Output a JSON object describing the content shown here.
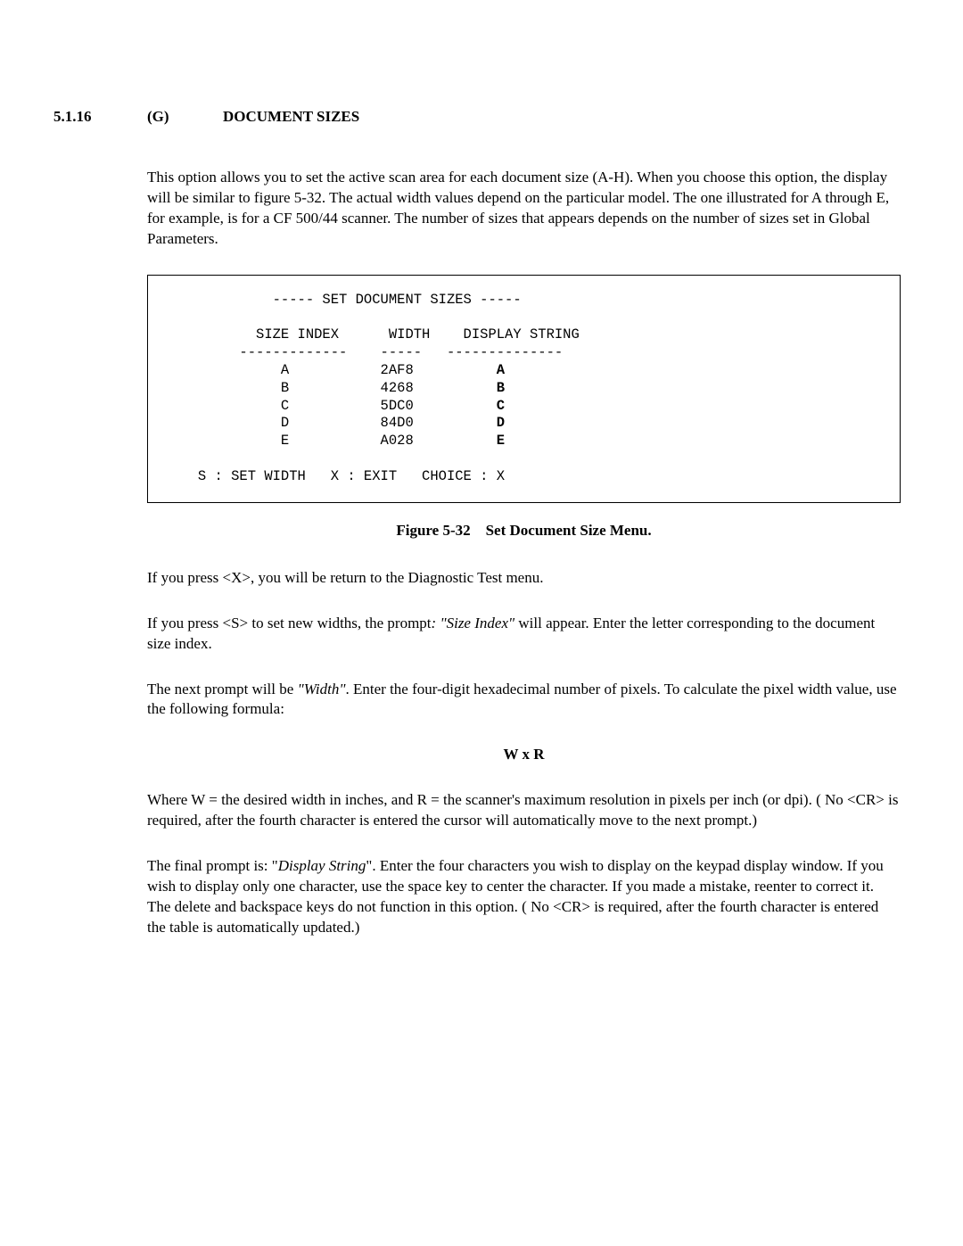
{
  "heading": {
    "num": "5.1.16",
    "letter": "(G)",
    "title": "DOCUMENT SIZES"
  },
  "para1": "This option allows you to set the active scan area for each document size (A-H).  When you choose this option, the display will be similar to figure 5-32.  The actual width values depend on the particular model.  The one illustrated for A through E, for example, is for a CF 500/44 scanner.  The number of sizes that appears depends on the number of sizes set in Global Parameters.",
  "figure": {
    "title": "----- SET DOCUMENT SIZES -----",
    "columns": {
      "c1": "SIZE INDEX",
      "c2": "WIDTH",
      "c3": "DISPLAY STRING"
    },
    "dividers": {
      "d1": "-------------",
      "d2": "-----",
      "d3": "--------------"
    },
    "rows": [
      {
        "idx": "A",
        "width": "2AF8",
        "disp": "A"
      },
      {
        "idx": "B",
        "width": "4268",
        "disp": "B"
      },
      {
        "idx": "C",
        "width": "5DC0",
        "disp": "C"
      },
      {
        "idx": "D",
        "width": "84D0",
        "disp": "D"
      },
      {
        "idx": "E",
        "width": "A028",
        "disp": "E"
      }
    ],
    "footer": "S : SET WIDTH   X : EXIT   CHOICE : X"
  },
  "caption": "Figure 5-32 Set Document Size Menu.",
  "para2": "If you press <X>, you will be return to the Diagnostic Test menu.",
  "para3a": "If you press <S> to set new widths, the prompt",
  "para3i": ": \"Size Index\"",
  "para3b": " will appear.  Enter the letter corresponding to the document size index.",
  "para4a": "The next prompt will be ",
  "para4i": "\"Width\"",
  "para4b": ".  Enter the four-digit hexadecimal number of pixels.  To calculate the pixel width value, use the following formula:",
  "formula": "W x R",
  "para5": "Where W =  the desired width in inches, and R =  the scanner's maximum resolution in pixels per inch (or dpi). ( No <CR> is required, after the fourth character is entered the cursor will automatically move to the next prompt.)",
  "para6a": "The final prompt is: \"",
  "para6i": "Display String",
  "para6b": "\".  Enter the four characters you wish to display on the keypad display window.  If you wish to display  only one character, use the space key to center the character.  If you made a mistake, reenter to correct it.  The delete and backspace keys do not function in this option. ( No <CR> is required, after the fourth character is entered the table is automatically updated.)"
}
